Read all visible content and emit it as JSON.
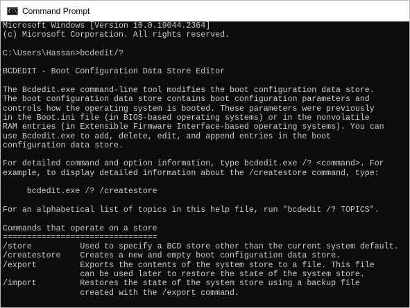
{
  "window": {
    "title": "Command Prompt",
    "icon": "console-icon",
    "icon_glyph": "C:\\"
  },
  "console": {
    "lines": [
      "Microsoft Windows [Version 10.0.19044.2364]",
      "(c) Microsoft Corporation. All rights reserved.",
      "",
      "C:\\Users\\Hassan>bcdedit/?",
      "",
      "BCDEDIT - Boot Configuration Data Store Editor",
      "",
      "The Bcdedit.exe command-line tool modifies the boot configuration data store.",
      "The boot configuration data store contains boot configuration parameters and",
      "controls how the operating system is booted. These parameters were previously",
      "in the Boot.ini file (in BIOS-based operating systems) or in the nonvolatile",
      "RAM entries (in Extensible Firmware Interface-based operating systems). You can",
      "use Bcdedit.exe to add, delete, edit, and append entries in the boot",
      "configuration data store.",
      "",
      "For detailed command and option information, type bcdedit.exe /? <command>. For",
      "example, to display detailed information about the /createstore command, type:",
      "",
      "     bcdedit.exe /? /createstore",
      "",
      "For an alphabetical list of topics in this help file, run \"bcdedit /? TOPICS\".",
      "",
      "Commands that operate on a store",
      "================================",
      "/store          Used to specify a BCD store other than the current system default.",
      "/createstore    Creates a new and empty boot configuration data store.",
      "/export         Exports the contents of the system store to a file. This file",
      "                can be used later to restore the state of the system store.",
      "/import         Restores the state of the system store using a backup file",
      "                created with the /export command."
    ]
  }
}
